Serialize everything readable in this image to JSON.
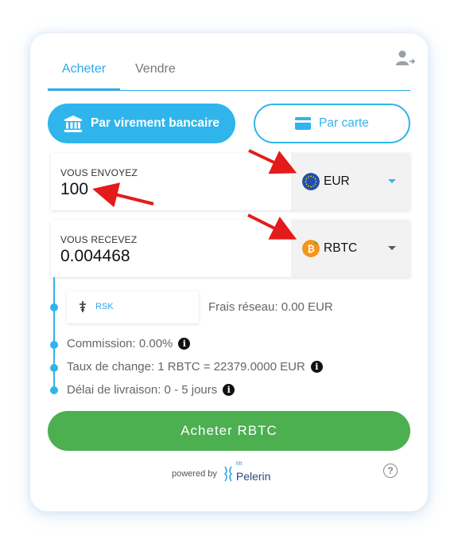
{
  "tabs": {
    "buy": "Acheter",
    "sell": "Vendre"
  },
  "payment": {
    "bank": "Par virement bancaire",
    "card": "Par carte"
  },
  "send": {
    "label": "VOUS ENVOYEZ",
    "value": "100",
    "currency": "EUR"
  },
  "receive": {
    "label": "VOUS RECEVEZ",
    "value": "0.004468",
    "currency": "RBTC"
  },
  "network": {
    "name": "RSK",
    "fee": "Frais réseau: 0.00 EUR"
  },
  "info": {
    "commission": "Commission: 0.00%",
    "rate": "Taux de change: 1 RBTC = 22379.0000 EUR",
    "delivery": "Délai de livraison: 0 - 5 jours"
  },
  "buy_button": "Acheter RBTC",
  "footer": {
    "powered": "powered by",
    "brand_small": "Mt",
    "brand": "Pelerin",
    "help": "?"
  },
  "colors": {
    "accent": "#2fb5ec",
    "buy": "#4caf50",
    "arrow": "#e31b1b",
    "eur": "#1f4fa8",
    "rbtc": "#f7931a"
  },
  "icons": {
    "info": "i"
  }
}
